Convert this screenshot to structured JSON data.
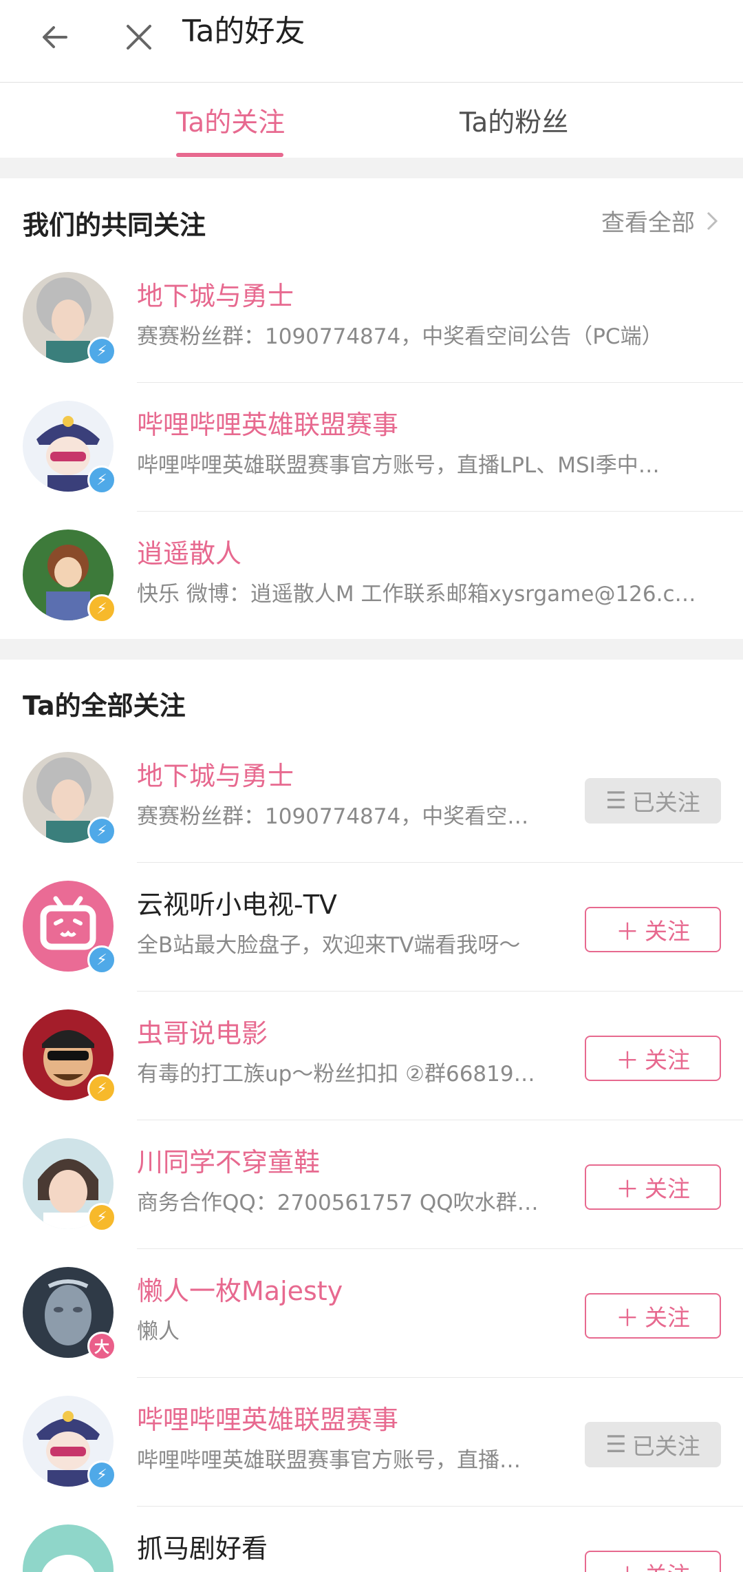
{
  "header": {
    "title": "Ta的好友"
  },
  "tabs": [
    {
      "label": "Ta的关注",
      "active": true
    },
    {
      "label": "Ta的粉丝",
      "active": false
    }
  ],
  "mutual": {
    "title": "我们的共同关注",
    "see_all": "查看全部",
    "items": [
      {
        "name": "地下城与勇士",
        "desc": "赛赛粉丝群：1090774874，中奖看空间公告（PC端）",
        "badge": "bolt-blue"
      },
      {
        "name": "哔哩哔哩英雄联盟赛事",
        "desc": "哔哩哔哩英雄联盟赛事官方账号，直播LPL、MSI季中…",
        "badge": "bolt-blue"
      },
      {
        "name": "逍遥散人",
        "desc": "快乐 微博：逍遥散人M 工作联系邮箱xysrgame@126.c…",
        "badge": "bolt-yellow"
      }
    ]
  },
  "all": {
    "title": "Ta的全部关注",
    "items": [
      {
        "name": "地下城与勇士",
        "desc": "赛赛粉丝群：1090774874，中奖看空…",
        "badge": "bolt-blue",
        "button": "已关注",
        "followed": true,
        "vip": true
      },
      {
        "name": "云视听小电视-TV",
        "desc": "全B站最大脸盘子，欢迎来TV端看我呀～",
        "badge": "bolt-blue",
        "button": "关注",
        "followed": false,
        "vip": false
      },
      {
        "name": "虫哥说电影",
        "desc": "有毒的打工族up～粉丝扣扣 ②群66819…",
        "badge": "bolt-yellow",
        "button": "关注",
        "followed": false,
        "vip": true
      },
      {
        "name": "川同学不穿童鞋",
        "desc": "商务合作QQ：2700561757 QQ吹水群…",
        "badge": "bolt-yellow",
        "button": "关注",
        "followed": false,
        "vip": true
      },
      {
        "name": "懒人一枚Majesty",
        "desc": "懒人",
        "badge": "big-pink",
        "badge_text": "大",
        "button": "关注",
        "followed": false,
        "vip": true
      },
      {
        "name": "哔哩哔哩英雄联盟赛事",
        "desc": "哔哩哔哩英雄联盟赛事官方账号，直播…",
        "badge": "bolt-blue",
        "button": "已关注",
        "followed": true,
        "vip": true
      },
      {
        "name": "抓马剧好看",
        "desc": "",
        "badge": "",
        "button": "关注",
        "followed": false,
        "vip": false
      }
    ]
  },
  "colors": {
    "accent": "#e7698f",
    "bolt_blue": "#4fa9e8",
    "bolt_yellow": "#f7b92b"
  }
}
